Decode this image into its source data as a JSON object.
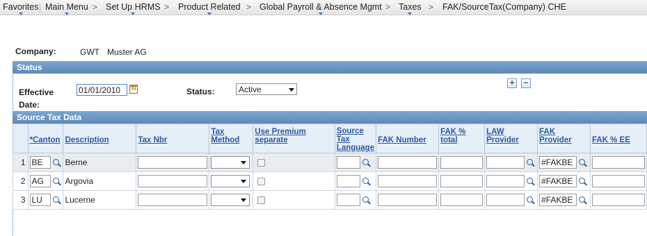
{
  "breadcrumb": {
    "items": [
      {
        "label": "Favorites",
        "has_menu": true
      },
      {
        "label": "Main Menu",
        "has_menu": true
      },
      {
        "label": "Set Up HRMS",
        "has_menu": true
      },
      {
        "label": "Product Related",
        "has_menu": true
      },
      {
        "label": "Global Payroll & Absence Mgmt",
        "has_menu": true
      },
      {
        "label": "Taxes",
        "has_menu": true
      },
      {
        "label": "FAK/SourceTax(Company) CHE",
        "has_menu": false
      }
    ],
    "separator": ">"
  },
  "company": {
    "label": "Company:",
    "code": "GWT",
    "name": "Muster AG"
  },
  "status_section": {
    "title": "Status",
    "effective_date_label_1": "Effective",
    "effective_date_label_2": "Date:",
    "effective_date_value": "01/01/2010",
    "status_label": "Status:",
    "status_value": "Active",
    "add_symbol": "+",
    "remove_symbol": "−"
  },
  "source_tax": {
    "title": "Source Tax Data",
    "columns": {
      "canton": "*Canton",
      "description": "Description",
      "tax_nbr": "Tax Nbr",
      "tax_method_1": "Tax",
      "tax_method_2": "Method",
      "use_premium": "Use Premium separate",
      "lang_1": "Source",
      "lang_2": "Tax",
      "lang_3": "Language",
      "fak_number": "FAK Number",
      "fak_total_1": "FAK %",
      "fak_total_2": "total",
      "law_provider_1": "LAW",
      "law_provider_2": "Provider",
      "fak_provider": "FAK Provider",
      "fak_ee": "FAK % EE"
    },
    "rows": [
      {
        "num": "1",
        "canton": "BE",
        "description": "Berne",
        "fak_provider": "#FAKBE"
      },
      {
        "num": "2",
        "canton": "AG",
        "description": "Argovia",
        "fak_provider": "#FAKBE"
      },
      {
        "num": "3",
        "canton": "LU",
        "description": "Lucerne",
        "fak_provider": "#FAKBE"
      }
    ]
  },
  "colors": {
    "section_header": "#6b96c4",
    "link_header": "#2b5aa3",
    "input_focus_border": "#4e80c6"
  },
  "icons": {
    "lookup": "magnifier-icon",
    "calendar": "calendar-icon",
    "dropdown": "chevron-down-icon",
    "cursor": "mouse-pointer-icon"
  }
}
